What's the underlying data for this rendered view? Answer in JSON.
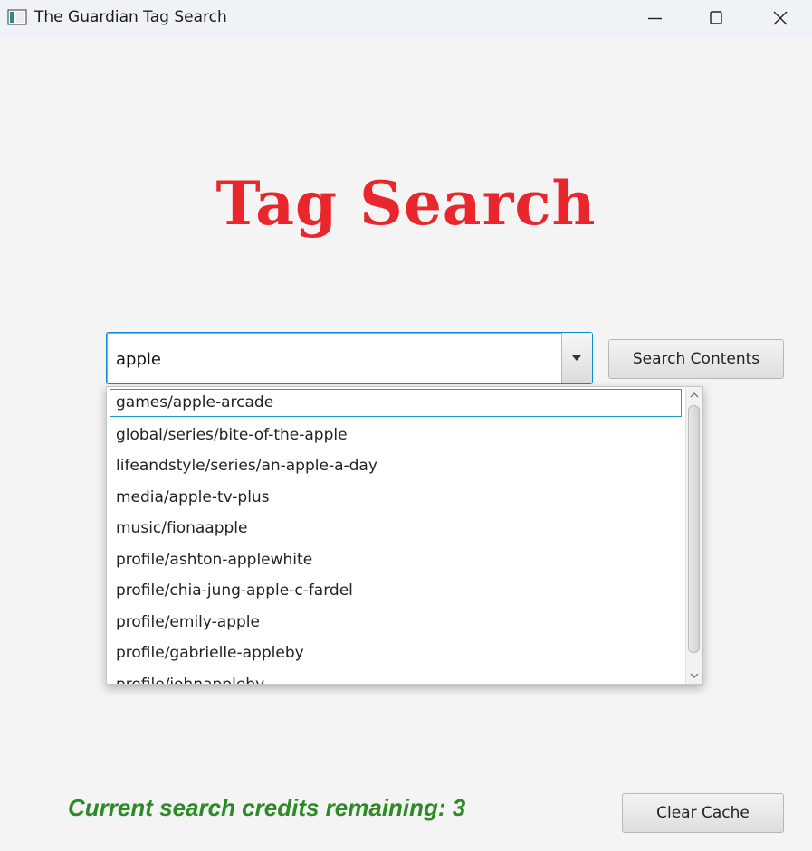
{
  "window": {
    "title": "The Guardian Tag Search"
  },
  "page": {
    "heading": "Tag Search",
    "heading_color": "#e8262b"
  },
  "search": {
    "value": "apple",
    "search_button_label": "Search Contents"
  },
  "dropdown": {
    "items": [
      "games/apple-arcade",
      "global/series/bite-of-the-apple",
      "lifeandstyle/series/an-apple-a-day",
      "media/apple-tv-plus",
      "music/fionaapple",
      "profile/ashton-applewhite",
      "profile/chia-jung-apple-c-fardel",
      "profile/emily-apple",
      "profile/gabrielle-appleby",
      "profile/johnappleby"
    ],
    "selected_index": 0
  },
  "footer": {
    "credits_text": "Current search credits remaining: 3",
    "credits_color": "#2d8a26",
    "clear_cache_label": "Clear Cache"
  },
  "icons": {
    "app": "app-window-icon",
    "minimize": "minimize-icon",
    "maximize": "maximize-icon",
    "close": "close-icon",
    "dropdown": "chevron-down-icon",
    "scroll_up": "scroll-up-icon",
    "scroll_down": "scroll-down-icon"
  }
}
